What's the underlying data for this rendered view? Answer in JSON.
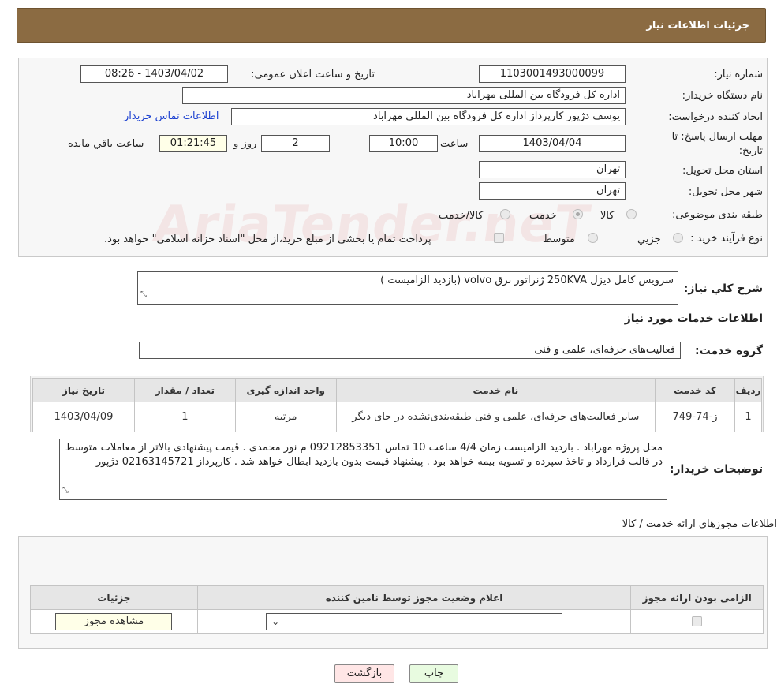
{
  "header": {
    "title": "جزئیات اطلاعات نیاز"
  },
  "need_number": {
    "label": "شماره نیاز:",
    "value": "1103001493000099"
  },
  "announce": {
    "label": "تاریخ و ساعت اعلان عمومی:",
    "value": "1403/04/02 - 08:26"
  },
  "buyer_org": {
    "label": "نام دستگاه خریدار:",
    "value": "اداره کل فرودگاه بین المللی مهراباد"
  },
  "creator": {
    "label": "ایجاد کننده درخواست:",
    "value": "یوسف دژپور کارپرداز اداره کل فرودگاه بین المللی مهراباد",
    "contact_link": "اطلاعات تماس خریدار"
  },
  "deadline": {
    "label_line1": "مهلت ارسال پاسخ: تا",
    "label_line2": "تاریخ:",
    "date": "1403/04/04",
    "time_label": "ساعت",
    "time": "10:00",
    "days": "2",
    "days_label": "روز و",
    "remaining": "01:21:45",
    "remaining_label": "ساعت باقي مانده"
  },
  "province": {
    "label": "استان محل تحویل:",
    "value": "تهران"
  },
  "city": {
    "label": "شهر محل تحویل:",
    "value": "تهران"
  },
  "category": {
    "label": "طبقه بندی موضوعی:",
    "opt_goods": "کالا",
    "opt_service": "خدمت",
    "opt_both": "کالا/خدمت",
    "selected": "خدمت"
  },
  "purchase_type": {
    "label": "نوع فرآیند خرید :",
    "opt_partial": "جزیي",
    "opt_medium": "متوسط",
    "note": "پرداخت تمام یا بخشی از مبلغ خرید،از محل \"اسناد خزانه اسلامی\" خواهد بود."
  },
  "summary": {
    "label": "شرح کلي نياز:",
    "value": "سرویس کامل دیزل 250KVA ژنراتور برق volvo (بازدید الزامیست )"
  },
  "services_section": {
    "title": "اطلاعات خدمات مورد نیاز"
  },
  "service_group": {
    "label": "گروه خدمت:",
    "value": "فعالیت‌های حرفه‌ای، علمی و فنی"
  },
  "service_table": {
    "headers": [
      "ردیف",
      "کد خدمت",
      "نام خدمت",
      "واحد اندازه گیری",
      "تعداد / مقدار",
      "تاریخ نیاز"
    ],
    "rows": [
      {
        "row": "1",
        "code": "ز-74-749",
        "name": "سایر فعالیت‌های حرفه‌ای، علمی و فنی طبقه‌بندی‌نشده در جای دیگر",
        "unit": "مرتبه",
        "qty": "1",
        "date": "1403/04/09"
      }
    ]
  },
  "buyer_notes": {
    "label": "توضیحات خریدار:",
    "value": "محل پروژه مهراباد . بازدید الزامیست زمان 4/4 ساعت 10 تماس 09212853351 م نور محمدی . قیمت پیشنهادی بالاتر از معاملات متوسط در قالب قرارداد و تاخذ سپرده و تسویه بیمه خواهد بود . پیشنهاد قیمت بدون بازدید ابطال خواهد شد . کارپرداز 02163145721 دژپور"
  },
  "permits_section": {
    "title": "اطلاعات مجوزهای ارائه خدمت / کالا"
  },
  "permits_table": {
    "headers": [
      "الزامی بودن ارائه مجوز",
      "اعلام وضعیت مجوز توسط نامین کننده",
      "جزئیات"
    ],
    "select_value": "--",
    "view_button": "مشاهده مجوز"
  },
  "actions": {
    "print": "چاپ",
    "back": "بازگشت"
  },
  "watermark": "AriaTender.neT",
  "colors": {
    "header_bg": "#8b6b42",
    "print_btn": "#e8fbe0",
    "back_btn": "#ffe6e6",
    "link": "#1a3fd0"
  }
}
